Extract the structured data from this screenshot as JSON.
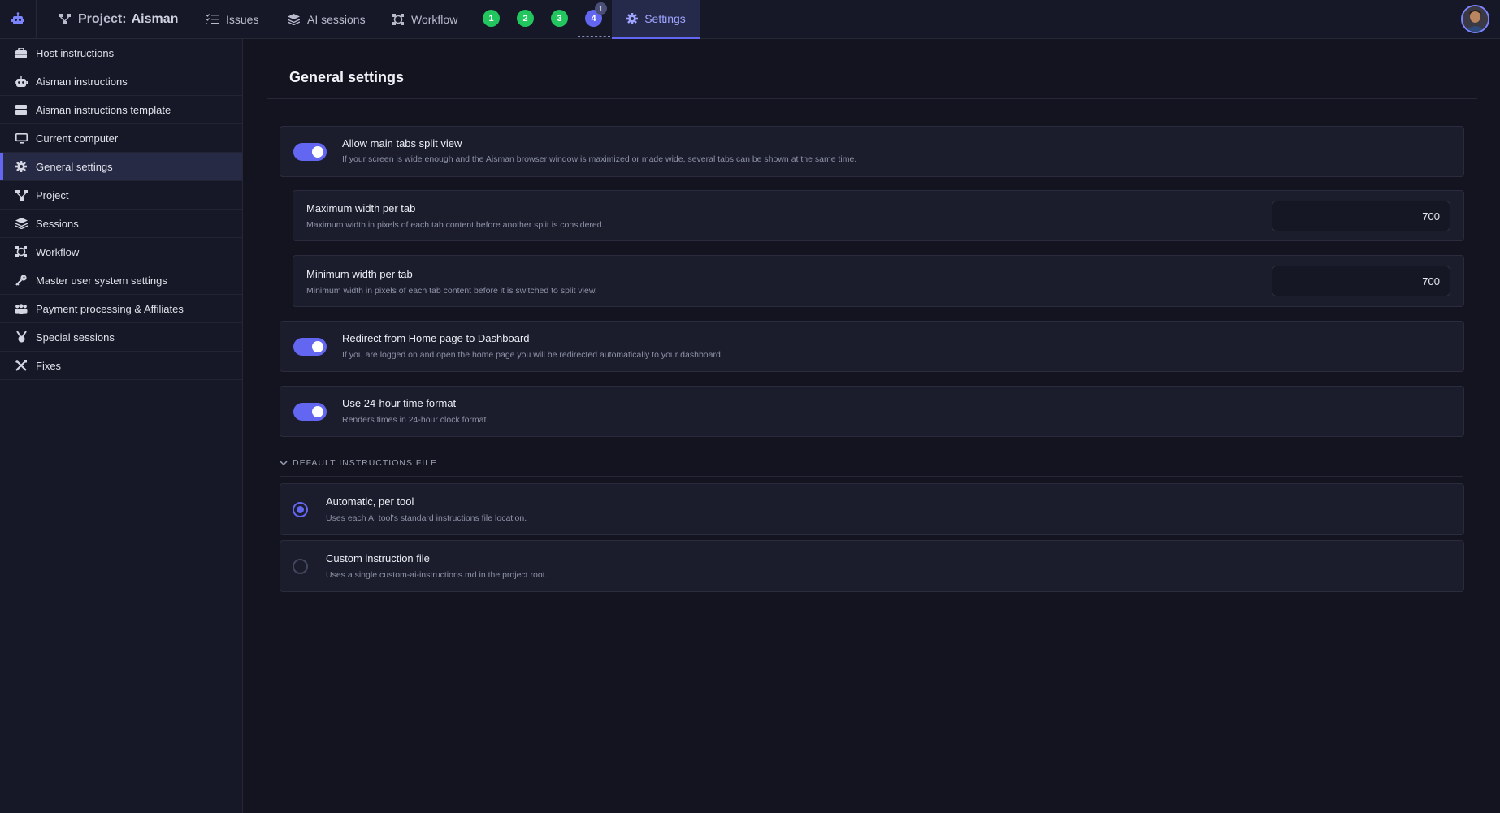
{
  "topbar": {
    "project_prefix": "Project:",
    "project_name": "Aisman",
    "nav": [
      {
        "label": "Issues",
        "icon": "checklist-icon"
      },
      {
        "label": "AI sessions",
        "icon": "layers-icon"
      },
      {
        "label": "Workflow",
        "icon": "workflow-icon"
      }
    ],
    "badges": [
      "1",
      "2",
      "3",
      "4"
    ],
    "badge_counter": "1",
    "settings_label": "Settings"
  },
  "sidebar": {
    "items": [
      {
        "label": "Host instructions",
        "icon": "host-icon"
      },
      {
        "label": "Aisman instructions",
        "icon": "robot-icon"
      },
      {
        "label": "Aisman instructions template",
        "icon": "server-icon"
      },
      {
        "label": "Current computer",
        "icon": "monitor-icon"
      },
      {
        "label": "General settings",
        "icon": "gear-icon",
        "active": true
      },
      {
        "label": "Project",
        "icon": "project-icon"
      },
      {
        "label": "Sessions",
        "icon": "layers-icon"
      },
      {
        "label": "Workflow",
        "icon": "workflow-icon"
      },
      {
        "label": "Master user system settings",
        "icon": "key-icon"
      },
      {
        "label": "Payment processing & Affiliates",
        "icon": "users-icon"
      },
      {
        "label": "Special sessions",
        "icon": "medal-icon"
      },
      {
        "label": "Fixes",
        "icon": "tools-icon"
      }
    ]
  },
  "main": {
    "title": "General settings",
    "split_view": {
      "title": "Allow main tabs split view",
      "desc": "If your screen is wide enough and the Aisman browser window is maximized or made wide, several tabs can be shown at the same time.",
      "enabled": true
    },
    "max_width": {
      "title": "Maximum width per tab",
      "desc": "Maximum width in pixels of each tab content before another split is considered.",
      "value": "700"
    },
    "min_width": {
      "title": "Minimum width per tab",
      "desc": "Minimum width in pixels of each tab content before it is switched to split view.",
      "value": "700"
    },
    "redirect": {
      "title": "Redirect from Home page to Dashboard",
      "desc": "If you are logged on and open the home page you will be redirected automatically to your dashboard",
      "enabled": true
    },
    "time_format": {
      "title": "Use 24-hour time format",
      "desc": "Renders times in 24-hour clock format.",
      "enabled": true
    },
    "instructions_section": {
      "label": "DEFAULT INSTRUCTIONS FILE",
      "options": [
        {
          "title": "Automatic, per tool",
          "desc": "Uses each AI tool's standard instructions file location.",
          "selected": true
        },
        {
          "title": "Custom instruction file",
          "desc": "Uses a single custom-ai-instructions.md in the project root.",
          "selected": false
        }
      ]
    }
  },
  "colors": {
    "accent": "#6366f1",
    "badge_green": "#22c55e",
    "background": "#13141f",
    "panel": "#1b1d2c"
  }
}
